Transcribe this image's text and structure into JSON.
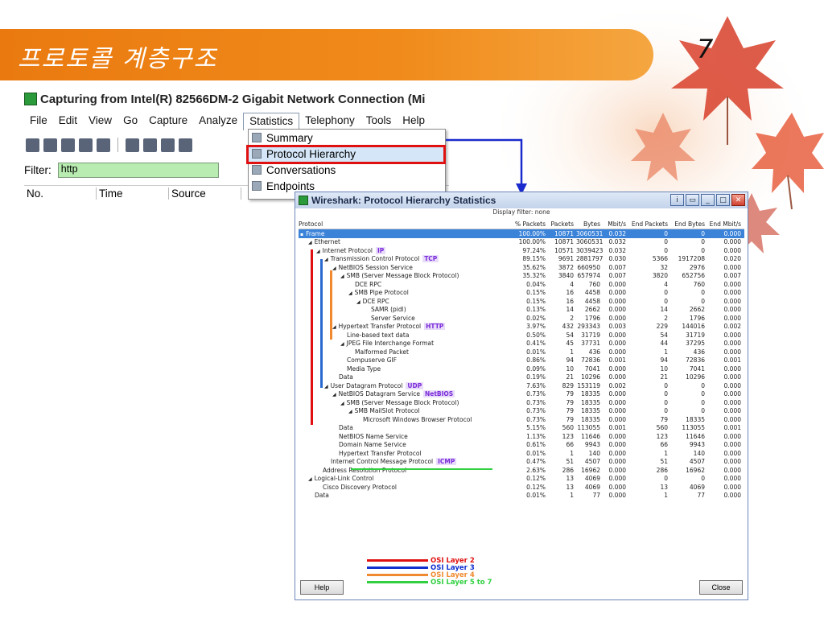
{
  "slide": {
    "title": "프로토콜 계층구조",
    "page_number": "7",
    "banner_color": "#ee7f14"
  },
  "capture_window": {
    "title": "Capturing from Intel(R) 82566DM-2 Gigabit Network Connection (Mi",
    "menu": [
      "File",
      "Edit",
      "View",
      "Go",
      "Capture",
      "Analyze",
      "Statistics",
      "Telephony",
      "Tools",
      "Help"
    ],
    "active_menu": "Statistics",
    "filter_label": "Filter:",
    "filter_value": "http",
    "columns": [
      "No.",
      "Time",
      "Source"
    ]
  },
  "statistics_menu": {
    "items": [
      "Summary",
      "Protocol Hierarchy",
      "Conversations",
      "Endpoints"
    ],
    "selected": "Protocol Hierarchy"
  },
  "hierarchy_window": {
    "title": "Wireshark: Protocol Hierarchy Statistics",
    "display_filter": "Display filter: none",
    "columns": [
      "Protocol",
      "% Packets",
      "Packets",
      "Bytes",
      "Mbit/s",
      "End Packets",
      "End Bytes",
      "End Mbit/s"
    ],
    "rows": [
      {
        "indent": 0,
        "exp": "▪",
        "name": "Frame",
        "tag": "",
        "pct": "100.00%",
        "pk": "10871",
        "by": "3060531",
        "mb": "0.032",
        "ep": "0",
        "eb": "0",
        "em": "0.000",
        "sel": true
      },
      {
        "indent": 1,
        "exp": "◢",
        "name": "Ethernet",
        "tag": "",
        "pct": "100.00%",
        "pk": "10871",
        "by": "3060531",
        "mb": "0.032",
        "ep": "0",
        "eb": "0",
        "em": "0.000"
      },
      {
        "indent": 2,
        "exp": "◢",
        "name": "Internet Protocol",
        "tag": "IP",
        "pct": "97.24%",
        "pk": "10571",
        "by": "3039423",
        "mb": "0.032",
        "ep": "0",
        "eb": "0",
        "em": "0.000"
      },
      {
        "indent": 3,
        "exp": "◢",
        "name": "Transmission Control Protocol",
        "tag": "TCP",
        "pct": "89.15%",
        "pk": "9691",
        "by": "2881797",
        "mb": "0.030",
        "ep": "5366",
        "eb": "1917208",
        "em": "0.020"
      },
      {
        "indent": 4,
        "exp": "◢",
        "name": "NetBIOS Session Service",
        "tag": "",
        "pct": "35.62%",
        "pk": "3872",
        "by": "660950",
        "mb": "0.007",
        "ep": "32",
        "eb": "2976",
        "em": "0.000"
      },
      {
        "indent": 5,
        "exp": "◢",
        "name": "SMB (Server Message Block Protocol)",
        "tag": "",
        "pct": "35.32%",
        "pk": "3840",
        "by": "657974",
        "mb": "0.007",
        "ep": "3820",
        "eb": "652756",
        "em": "0.007"
      },
      {
        "indent": 6,
        "exp": "",
        "name": "DCE RPC",
        "tag": "",
        "pct": "0.04%",
        "pk": "4",
        "by": "760",
        "mb": "0.000",
        "ep": "4",
        "eb": "760",
        "em": "0.000"
      },
      {
        "indent": 6,
        "exp": "◢",
        "name": "SMB Pipe Protocol",
        "tag": "",
        "pct": "0.15%",
        "pk": "16",
        "by": "4458",
        "mb": "0.000",
        "ep": "0",
        "eb": "0",
        "em": "0.000"
      },
      {
        "indent": 7,
        "exp": "◢",
        "name": "DCE RPC",
        "tag": "",
        "pct": "0.15%",
        "pk": "16",
        "by": "4458",
        "mb": "0.000",
        "ep": "0",
        "eb": "0",
        "em": "0.000"
      },
      {
        "indent": 8,
        "exp": "",
        "name": "SAMR (pidl)",
        "tag": "",
        "pct": "0.13%",
        "pk": "14",
        "by": "2662",
        "mb": "0.000",
        "ep": "14",
        "eb": "2662",
        "em": "0.000"
      },
      {
        "indent": 8,
        "exp": "",
        "name": "Server Service",
        "tag": "",
        "pct": "0.02%",
        "pk": "2",
        "by": "1796",
        "mb": "0.000",
        "ep": "2",
        "eb": "1796",
        "em": "0.000"
      },
      {
        "indent": 4,
        "exp": "◢",
        "name": "Hypertext Transfer Protocol",
        "tag": "HTTP",
        "pct": "3.97%",
        "pk": "432",
        "by": "293343",
        "mb": "0.003",
        "ep": "229",
        "eb": "144016",
        "em": "0.002"
      },
      {
        "indent": 5,
        "exp": "",
        "name": "Line-based text data",
        "tag": "",
        "pct": "0.50%",
        "pk": "54",
        "by": "31719",
        "mb": "0.000",
        "ep": "54",
        "eb": "31719",
        "em": "0.000"
      },
      {
        "indent": 5,
        "exp": "◢",
        "name": "JPEG File Interchange Format",
        "tag": "",
        "pct": "0.41%",
        "pk": "45",
        "by": "37731",
        "mb": "0.000",
        "ep": "44",
        "eb": "37295",
        "em": "0.000"
      },
      {
        "indent": 6,
        "exp": "",
        "name": "Malformed Packet",
        "tag": "",
        "pct": "0.01%",
        "pk": "1",
        "by": "436",
        "mb": "0.000",
        "ep": "1",
        "eb": "436",
        "em": "0.000"
      },
      {
        "indent": 5,
        "exp": "",
        "name": "Compuserve GIF",
        "tag": "",
        "pct": "0.86%",
        "pk": "94",
        "by": "72836",
        "mb": "0.001",
        "ep": "94",
        "eb": "72836",
        "em": "0.001"
      },
      {
        "indent": 5,
        "exp": "",
        "name": "Media Type",
        "tag": "",
        "pct": "0.09%",
        "pk": "10",
        "by": "7041",
        "mb": "0.000",
        "ep": "10",
        "eb": "7041",
        "em": "0.000"
      },
      {
        "indent": 4,
        "exp": "",
        "name": "Data",
        "tag": "",
        "pct": "0.19%",
        "pk": "21",
        "by": "10296",
        "mb": "0.000",
        "ep": "21",
        "eb": "10296",
        "em": "0.000"
      },
      {
        "indent": 3,
        "exp": "◢",
        "name": "User Datagram Protocol",
        "tag": "UDP",
        "pct": "7.63%",
        "pk": "829",
        "by": "153119",
        "mb": "0.002",
        "ep": "0",
        "eb": "0",
        "em": "0.000"
      },
      {
        "indent": 4,
        "exp": "◢",
        "name": "NetBIOS Datagram Service",
        "tag": "NetBIOS",
        "pct": "0.73%",
        "pk": "79",
        "by": "18335",
        "mb": "0.000",
        "ep": "0",
        "eb": "0",
        "em": "0.000"
      },
      {
        "indent": 5,
        "exp": "◢",
        "name": "SMB (Server Message Block Protocol)",
        "tag": "",
        "pct": "0.73%",
        "pk": "79",
        "by": "18335",
        "mb": "0.000",
        "ep": "0",
        "eb": "0",
        "em": "0.000"
      },
      {
        "indent": 6,
        "exp": "◢",
        "name": "SMB MailSlot Protocol",
        "tag": "",
        "pct": "0.73%",
        "pk": "79",
        "by": "18335",
        "mb": "0.000",
        "ep": "0",
        "eb": "0",
        "em": "0.000"
      },
      {
        "indent": 7,
        "exp": "",
        "name": "Microsoft Windows Browser Protocol",
        "tag": "",
        "pct": "0.73%",
        "pk": "79",
        "by": "18335",
        "mb": "0.000",
        "ep": "79",
        "eb": "18335",
        "em": "0.000"
      },
      {
        "indent": 4,
        "exp": "",
        "name": "Data",
        "tag": "",
        "pct": "5.15%",
        "pk": "560",
        "by": "113055",
        "mb": "0.001",
        "ep": "560",
        "eb": "113055",
        "em": "0.001"
      },
      {
        "indent": 4,
        "exp": "",
        "name": "NetBIOS Name Service",
        "tag": "",
        "pct": "1.13%",
        "pk": "123",
        "by": "11646",
        "mb": "0.000",
        "ep": "123",
        "eb": "11646",
        "em": "0.000"
      },
      {
        "indent": 4,
        "exp": "",
        "name": "Domain Name Service",
        "tag": "",
        "pct": "0.61%",
        "pk": "66",
        "by": "9943",
        "mb": "0.000",
        "ep": "66",
        "eb": "9943",
        "em": "0.000"
      },
      {
        "indent": 4,
        "exp": "",
        "name": "Hypertext Transfer Protocol",
        "tag": "",
        "pct": "0.01%",
        "pk": "1",
        "by": "140",
        "mb": "0.000",
        "ep": "1",
        "eb": "140",
        "em": "0.000"
      },
      {
        "indent": 3,
        "exp": "",
        "name": "Internet Control Message Protocol",
        "tag": "ICMP",
        "pct": "0.47%",
        "pk": "51",
        "by": "4507",
        "mb": "0.000",
        "ep": "51",
        "eb": "4507",
        "em": "0.000"
      },
      {
        "indent": 2,
        "exp": "",
        "name": "Address Resolution Protocol",
        "tag": "",
        "pct": "2.63%",
        "pk": "286",
        "by": "16962",
        "mb": "0.000",
        "ep": "286",
        "eb": "16962",
        "em": "0.000"
      },
      {
        "indent": 1,
        "exp": "◢",
        "name": "Logical-Link Control",
        "tag": "",
        "pct": "0.12%",
        "pk": "13",
        "by": "4069",
        "mb": "0.000",
        "ep": "0",
        "eb": "0",
        "em": "0.000"
      },
      {
        "indent": 2,
        "exp": "",
        "name": "Cisco Discovery Protocol",
        "tag": "",
        "pct": "0.12%",
        "pk": "13",
        "by": "4069",
        "mb": "0.000",
        "ep": "13",
        "eb": "4069",
        "em": "0.000"
      },
      {
        "indent": 1,
        "exp": "",
        "name": "Data",
        "tag": "",
        "pct": "0.01%",
        "pk": "1",
        "by": "77",
        "mb": "0.000",
        "ep": "1",
        "eb": "77",
        "em": "0.000"
      }
    ],
    "help_label": "Help",
    "close_label": "Close"
  },
  "legend": [
    {
      "label": "OSI Layer 2",
      "color": "#e01010"
    },
    {
      "label": "OSI Layer 3",
      "color": "#1030d0"
    },
    {
      "label": "OSI Layer 4",
      "color": "#f08a30"
    },
    {
      "label": "OSI Layer 5 to 7",
      "color": "#30d040"
    }
  ],
  "layer_colors": {
    "layer2": "#e01010",
    "layer3": "#2a6ad0",
    "layer4": "#f08a30",
    "layer57": "#30d040",
    "arrow": "#1a2acc"
  }
}
